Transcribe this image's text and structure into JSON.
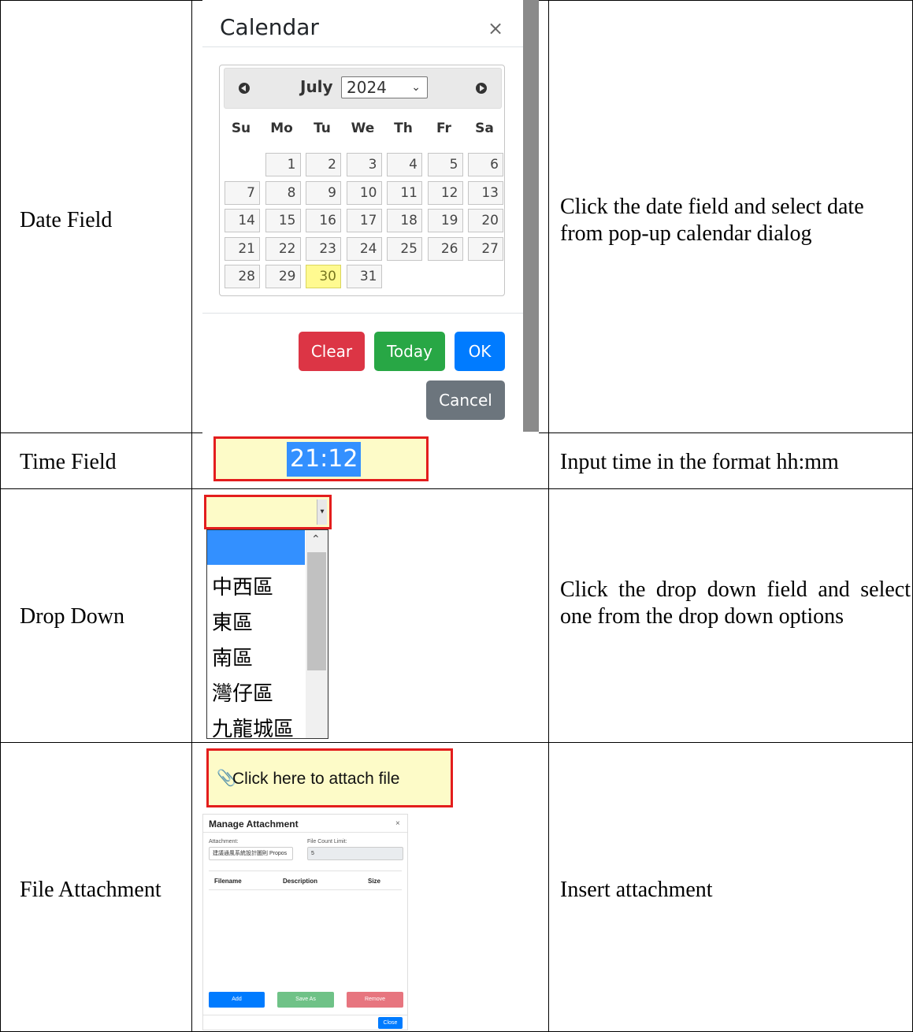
{
  "rows": [
    {
      "label": "Date Field",
      "description": "Click the date field and select date from pop-up calendar dialog"
    },
    {
      "label": "Time Field",
      "description": "Input time in the format hh:mm"
    },
    {
      "label": "Drop Down",
      "description": "Click the drop down field and select one from the drop down options"
    },
    {
      "label": "File Attachment",
      "description": "Insert attachment"
    }
  ],
  "calendar": {
    "title": "Calendar",
    "close": "×",
    "month": "July",
    "year": "2024",
    "weekdays": [
      "Su",
      "Mo",
      "Tu",
      "We",
      "Th",
      "Fr",
      "Sa"
    ],
    "days": [
      "1",
      "2",
      "3",
      "4",
      "5",
      "6",
      "7",
      "8",
      "9",
      "10",
      "11",
      "12",
      "13",
      "14",
      "15",
      "16",
      "17",
      "18",
      "19",
      "20",
      "21",
      "22",
      "23",
      "24",
      "25",
      "26",
      "27",
      "28",
      "29",
      "30",
      "31"
    ],
    "first_weekday_index": 1,
    "highlighted_day": "30",
    "buttons": {
      "clear": "Clear",
      "today": "Today",
      "ok": "OK",
      "cancel": "Cancel"
    },
    "colors": {
      "clear": "#dc3545",
      "today": "#28a745",
      "ok": "#007bff",
      "cancel": "#6c757d",
      "highlight": "#fffa90"
    }
  },
  "time": {
    "value": "21:12"
  },
  "dropdown": {
    "options": [
      "中西區",
      "東區",
      "南區",
      "灣仔區",
      "九龍城區"
    ]
  },
  "attach": {
    "label": "Click here to attach file",
    "dialog": {
      "title": "Manage Attachment",
      "close": "×",
      "attachment_label": "Attachment:",
      "attachment_value": "建議通風系統設計圖則 Propos",
      "limit_label": "File Count Limit:",
      "limit_value": "5",
      "columns": [
        "Filename",
        "Description",
        "Size"
      ],
      "buttons": {
        "add": "Add",
        "save_as": "Save As",
        "remove": "Remove",
        "close": "Close"
      }
    }
  }
}
